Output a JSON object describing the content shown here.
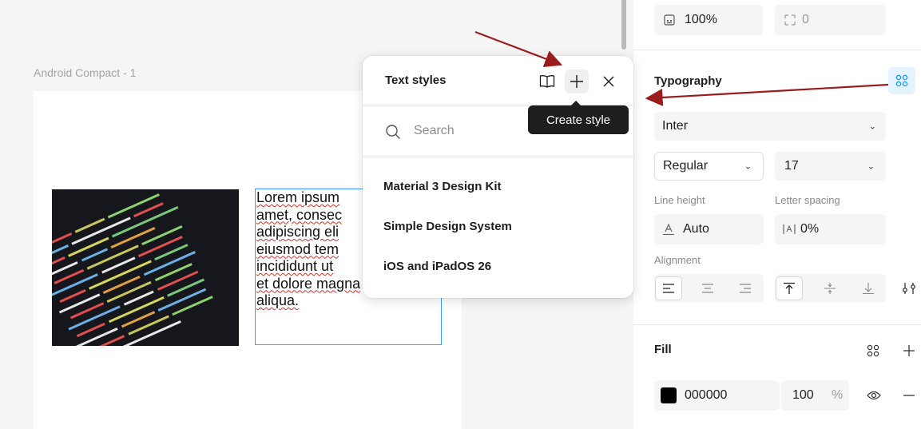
{
  "canvas": {
    "frame_label": "Android Compact - 1",
    "text_lines": [
      "Lorem ipsum",
      "amet, consec",
      "adipiscing eli",
      "eiusmod tem",
      "incididunt ut",
      "et dolore magna",
      "aliqua."
    ]
  },
  "text_styles_popup": {
    "title": "Text styles",
    "search_placeholder": "Search",
    "libraries": [
      "Material 3 Design Kit",
      "Simple Design System",
      "iOS and iPadOS 26"
    ],
    "tooltip": "Create style"
  },
  "panel": {
    "opacity": "100%",
    "corner_radius": "0",
    "typography": {
      "title": "Typography",
      "font_family": "Inter",
      "font_weight": "Regular",
      "font_size": "17",
      "line_height_label": "Line height",
      "line_height_value": "Auto",
      "letter_spacing_label": "Letter spacing",
      "letter_spacing_value": "0%",
      "alignment_label": "Alignment"
    },
    "fill": {
      "title": "Fill",
      "hex": "000000",
      "opacity": "100",
      "opacity_unit": "%",
      "color": "#000000"
    }
  },
  "colors": {
    "accent_blue": "#0d99ff",
    "annotation_arrow": "#9b1c1c",
    "selection_border": "#3b9cff"
  }
}
